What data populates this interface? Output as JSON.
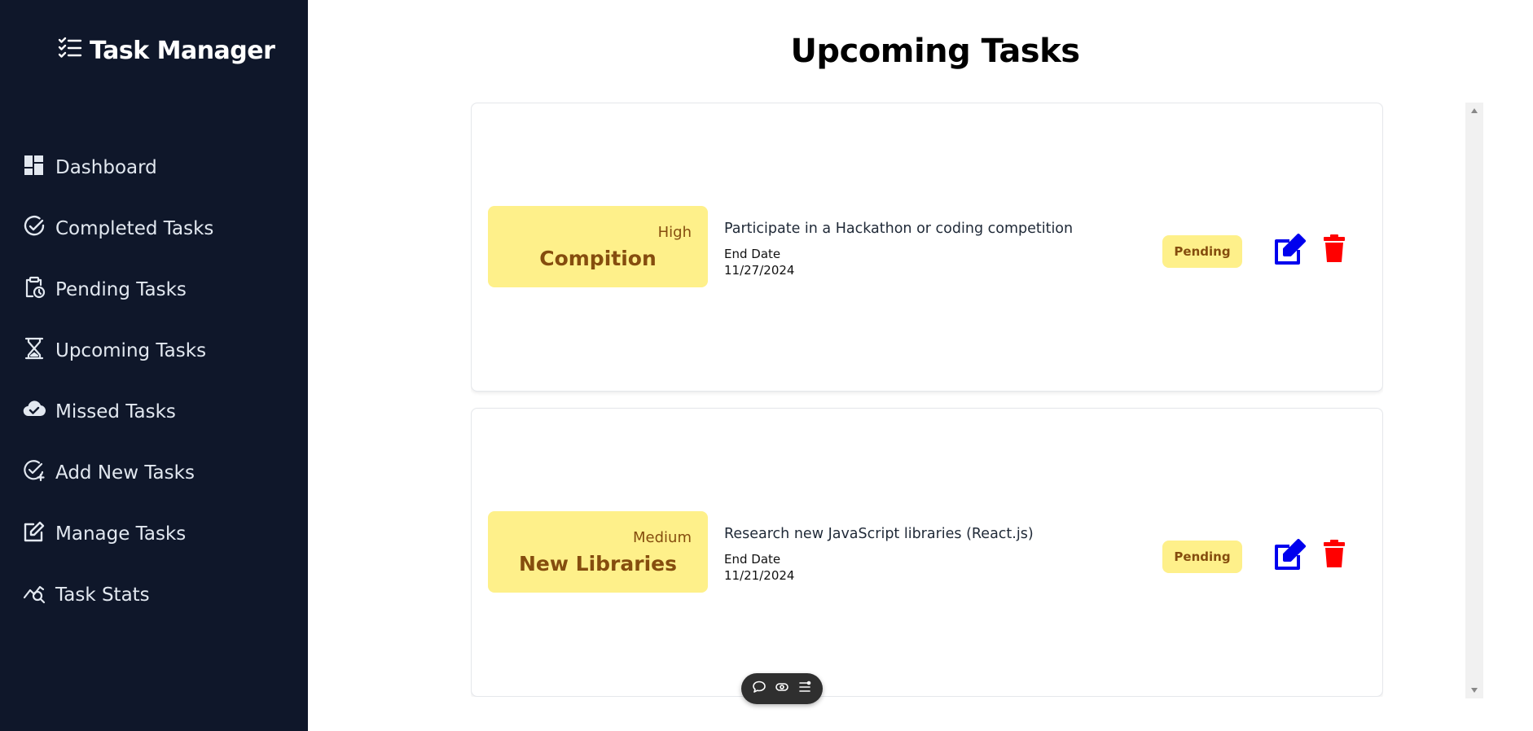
{
  "app": {
    "title": "Task Manager"
  },
  "sidebar": {
    "items": [
      {
        "label": "Dashboard",
        "icon": "dashboard-icon"
      },
      {
        "label": "Completed Tasks",
        "icon": "check-circle-icon"
      },
      {
        "label": "Pending Tasks",
        "icon": "clipboard-clock-icon"
      },
      {
        "label": "Upcoming Tasks",
        "icon": "hourglass-icon"
      },
      {
        "label": "Missed Tasks",
        "icon": "cloud-check-icon"
      },
      {
        "label": "Add New Tasks",
        "icon": "check-plus-icon"
      },
      {
        "label": "Manage Tasks",
        "icon": "edit-square-icon"
      },
      {
        "label": "Task Stats",
        "icon": "chart-search-icon"
      }
    ]
  },
  "main": {
    "title": "Upcoming Tasks",
    "tasks": [
      {
        "priority": "High",
        "title": "Compition",
        "description": "Participate in a Hackathon or coding competition",
        "end_date_label": "End Date",
        "end_date": "11/27/2024",
        "status": "Pending"
      },
      {
        "priority": "Medium",
        "title": "New Libraries",
        "description": "Research new JavaScript libraries (React.js)",
        "end_date_label": "End Date",
        "end_date": "11/21/2024",
        "status": "Pending"
      }
    ]
  },
  "colors": {
    "sidebar_bg": "#0f172a",
    "tag_bg": "#fef08a",
    "tag_text": "#854d0e",
    "edit": "#0000ee",
    "delete": "#ff0000"
  },
  "floating_toolbar": {
    "icons": [
      "chat-bubble-icon",
      "eye-icon",
      "list-settings-icon"
    ]
  }
}
